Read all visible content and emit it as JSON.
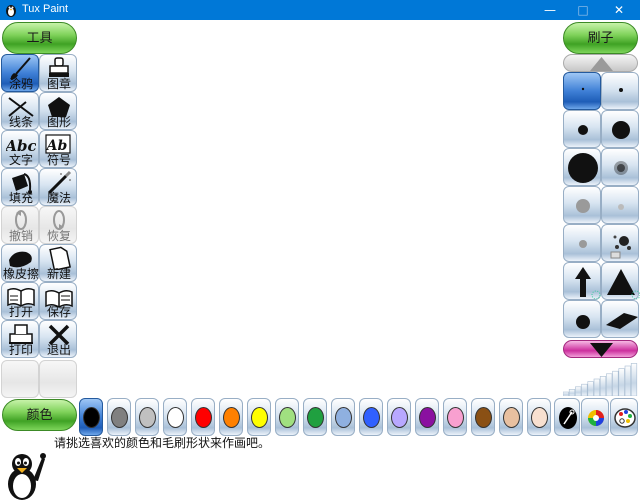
{
  "window": {
    "title": "Tux Paint",
    "minimize": "—",
    "maximize": "□",
    "close": "✕"
  },
  "tools_header": "工具",
  "brushes_header": "刷子",
  "colors_header": "颜色",
  "tools": [
    {
      "label": "涂鸦",
      "icon": "paint-brush-icon",
      "state": "active"
    },
    {
      "label": "图章",
      "icon": "stamp-icon",
      "state": "normal"
    },
    {
      "label": "线条",
      "icon": "lines-icon",
      "state": "normal"
    },
    {
      "label": "图形",
      "icon": "pentagon-icon",
      "state": "normal"
    },
    {
      "label": "文字",
      "icon": "text-icon",
      "state": "normal"
    },
    {
      "label": "符号",
      "icon": "label-icon",
      "state": "normal"
    },
    {
      "label": "填充",
      "icon": "fill-bucket-icon",
      "state": "normal"
    },
    {
      "label": "魔法",
      "icon": "magic-wand-icon",
      "state": "normal"
    },
    {
      "label": "撤销",
      "icon": "undo-icon",
      "state": "disabled"
    },
    {
      "label": "恢复",
      "icon": "redo-icon",
      "state": "disabled"
    },
    {
      "label": "橡皮擦",
      "icon": "eraser-icon",
      "state": "normal"
    },
    {
      "label": "新建",
      "icon": "new-file-icon",
      "state": "normal"
    },
    {
      "label": "打开",
      "icon": "open-book-icon",
      "state": "normal"
    },
    {
      "label": "保存",
      "icon": "save-book-icon",
      "state": "normal"
    },
    {
      "label": "打印",
      "icon": "printer-icon",
      "state": "normal"
    },
    {
      "label": "退出",
      "icon": "quit-icon",
      "state": "normal"
    }
  ],
  "tool_text_icons": {
    "text": "Abc",
    "label": "Ab"
  },
  "brushes": [
    "tiny-dot-brush",
    "small-dot-brush",
    "medium-dot-brush",
    "large-dot-brush",
    "huge-dot-brush",
    "fuzzy-dot-brush",
    "soft-dot-brush",
    "faint-dot-brush",
    "gray-dot-brush",
    "splatter-brush",
    "arrow-up-brush",
    "triangle-brush",
    "dot-brush",
    "diamond-brush"
  ],
  "palette": [
    {
      "name": "black",
      "hex": "#000000"
    },
    {
      "name": "dark-gray",
      "hex": "#808080"
    },
    {
      "name": "light-gray",
      "hex": "#c0c0c0"
    },
    {
      "name": "white",
      "hex": "#ffffff"
    },
    {
      "name": "red",
      "hex": "#ff0000"
    },
    {
      "name": "orange",
      "hex": "#ff8000"
    },
    {
      "name": "yellow",
      "hex": "#ffff00"
    },
    {
      "name": "light-green",
      "hex": "#a0e080"
    },
    {
      "name": "green",
      "hex": "#20a040"
    },
    {
      "name": "sky-blue",
      "hex": "#8fb0e0"
    },
    {
      "name": "blue",
      "hex": "#3060ff"
    },
    {
      "name": "lavender",
      "hex": "#b8a8ff"
    },
    {
      "name": "purple",
      "hex": "#8a10a0"
    },
    {
      "name": "pink",
      "hex": "#f8a0d0"
    },
    {
      "name": "brown",
      "hex": "#8a5014"
    },
    {
      "name": "tan",
      "hex": "#e8c0a0"
    },
    {
      "name": "beige",
      "hex": "#f8e0d0"
    }
  ],
  "selected_color": "black",
  "tip_text": "请挑选喜欢的颜色和毛刷形状来作画吧。"
}
